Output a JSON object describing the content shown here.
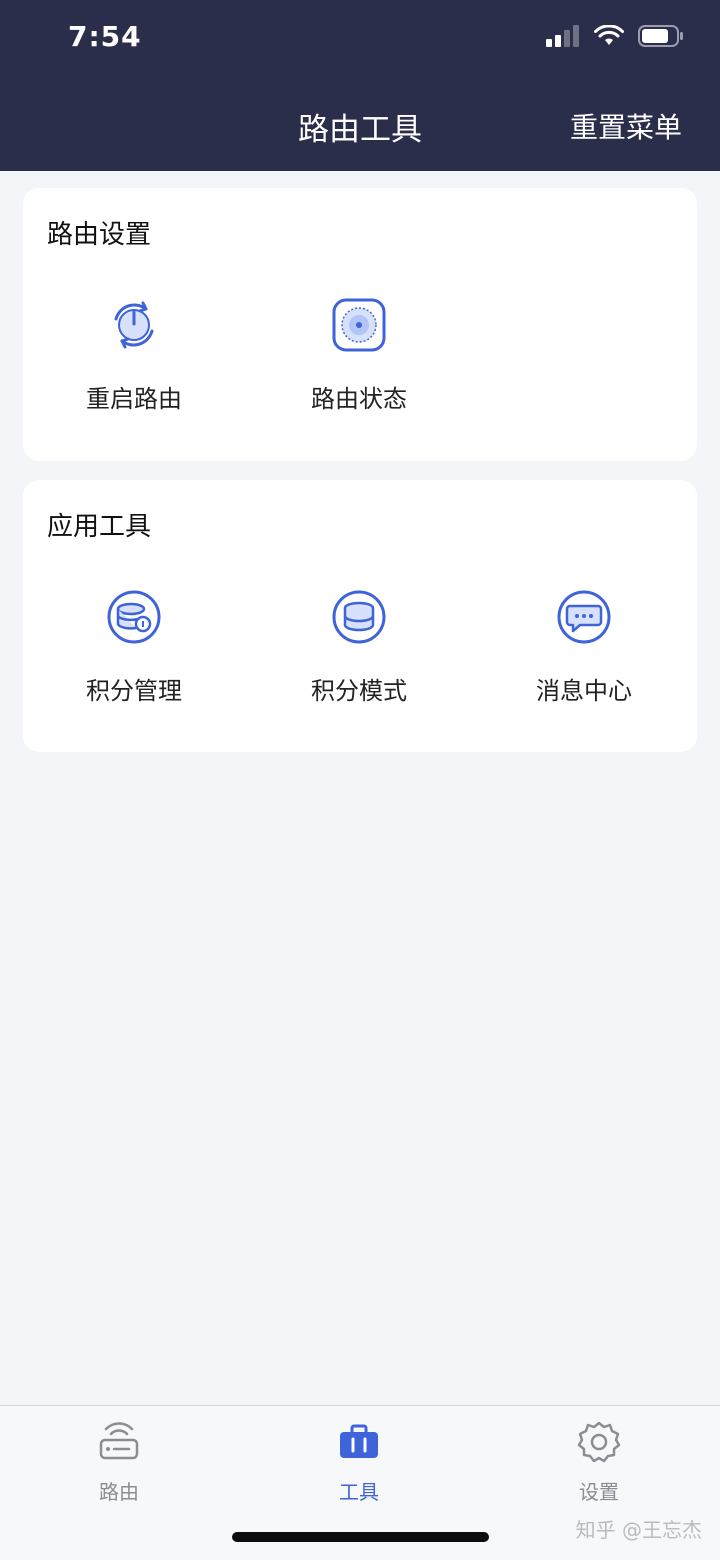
{
  "status_bar": {
    "time": "7:54"
  },
  "nav": {
    "title": "路由工具",
    "action": "重置菜单"
  },
  "router_section": {
    "title": "路由设置",
    "items": [
      {
        "label": "重启路由",
        "icon": "restart-icon"
      },
      {
        "label": "路由状态",
        "icon": "router-status-icon"
      }
    ]
  },
  "app_section": {
    "title": "应用工具",
    "items": [
      {
        "label": "积分管理",
        "icon": "points-manage-icon"
      },
      {
        "label": "积分模式",
        "icon": "points-mode-icon"
      },
      {
        "label": "消息中心",
        "icon": "message-center-icon"
      }
    ]
  },
  "tabbar": {
    "items": [
      {
        "label": "路由",
        "icon": "router-icon",
        "active": false
      },
      {
        "label": "工具",
        "icon": "toolbox-icon",
        "active": true
      },
      {
        "label": "设置",
        "icon": "gear-icon",
        "active": false
      }
    ]
  },
  "colors": {
    "header_bg": "#2b2e4a",
    "accent": "#3f63d8",
    "page_bg": "#f3f5f9"
  },
  "watermark": "知乎 @王忘杰"
}
